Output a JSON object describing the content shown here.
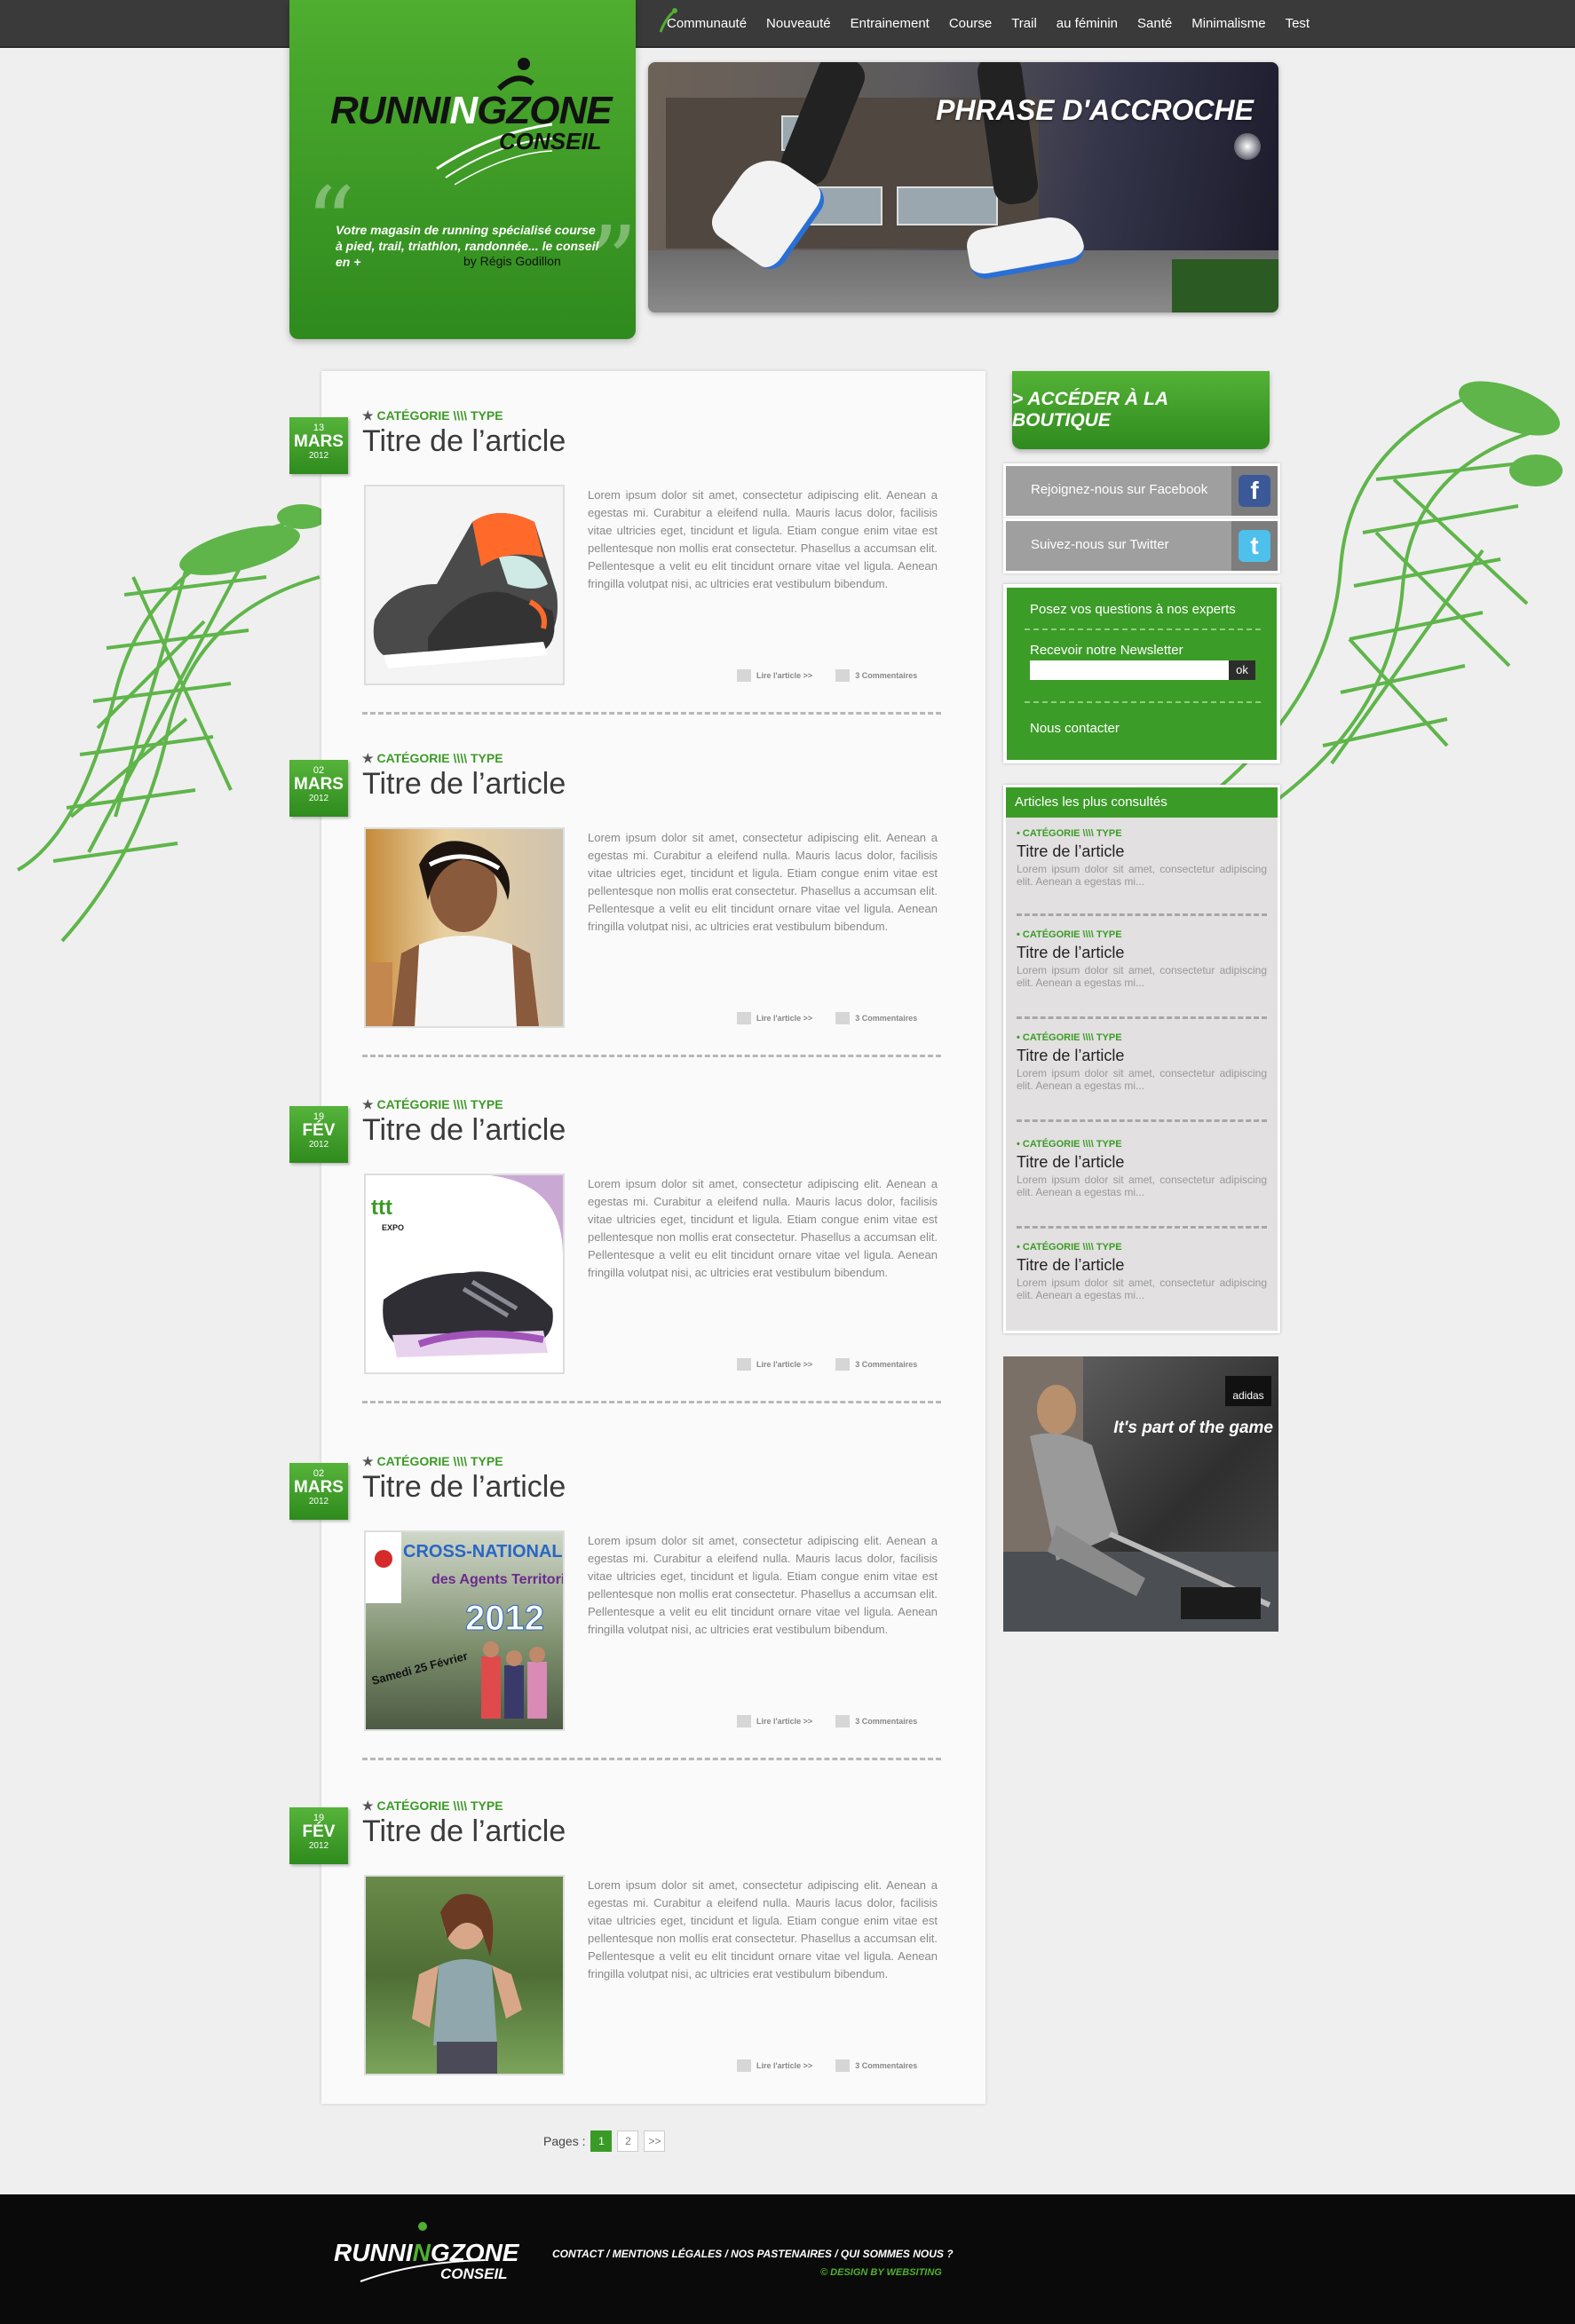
{
  "nav": {
    "items": [
      "Communauté",
      "Nouveauté",
      "Entrainement",
      "Course",
      "Trail",
      "au féminin",
      "Santé",
      "Minimalisme",
      "Test"
    ]
  },
  "brand": {
    "logo_main_left": "RUNNI",
    "logo_main_n": "N",
    "logo_main_right": "G",
    "logo_zone": "ZONE",
    "logo_sub": "CONSEIL",
    "tagline": "Votre magasin de running spécialisé course à pied, trail, triathlon, randonnée... le conseil en +",
    "tagline_author": "by Régis Godillon"
  },
  "hero": {
    "caption": "PHRASE D'ACCROCHE"
  },
  "articles": [
    {
      "day": "13",
      "month": "MARS",
      "year": "2012",
      "category_prefix": "CATÉGORIE",
      "category_sep": "\\\\\\\\",
      "category_type": "TYPE",
      "title": "Titre de l’article",
      "body": "Lorem ipsum dolor sit amet, consectetur adipiscing elit. Aenean a egestas mi. Curabitur a eleifend nulla. Mauris lacus dolor, facilisis vitae ultricies eget, tincidunt et ligula. Etiam congue enim vitae est pellentesque non mollis erat consectetur. Phasellus a accumsan elit. Pellentesque a velit eu elit tincidunt ornare vitae vel ligula. Aenean fringilla volutpat nisi, ac ultricies erat vestibulum bibendum.",
      "read_more": "Lire l'article  >>",
      "comments": "3 Commentaires"
    },
    {
      "day": "02",
      "month": "MARS",
      "year": "2012",
      "category_prefix": "CATÉGORIE",
      "category_sep": "\\\\\\\\",
      "category_type": "TYPE",
      "title": "Titre de l’article",
      "body": "Lorem ipsum dolor sit amet, consectetur adipiscing elit. Aenean a egestas mi. Curabitur a eleifend nulla. Mauris lacus dolor, facilisis vitae ultricies eget, tincidunt et ligula. Etiam congue enim vitae est pellentesque non mollis erat consectetur. Phasellus a accumsan elit. Pellentesque a velit eu elit tincidunt ornare vitae vel ligula. Aenean fringilla volutpat nisi, ac ultricies erat vestibulum bibendum.",
      "read_more": "Lire l'article  >>",
      "comments": "3 Commentaires"
    },
    {
      "day": "19",
      "month": "FÉV",
      "year": "2012",
      "category_prefix": "CATÉGORIE",
      "category_sep": "\\\\\\\\",
      "category_type": "TYPE",
      "title": "Titre de l’article",
      "body": "Lorem ipsum dolor sit amet, consectetur adipiscing elit. Aenean a egestas mi. Curabitur a eleifend nulla. Mauris lacus dolor, facilisis vitae ultricies eget, tincidunt et ligula. Etiam congue enim vitae est pellentesque non mollis erat consectetur. Phasellus a accumsan elit. Pellentesque a velit eu elit tincidunt ornare vitae vel ligula. Aenean fringilla volutpat nisi, ac ultricies erat vestibulum bibendum.",
      "read_more": "Lire l'article  >>",
      "comments": "3 Commentaires"
    },
    {
      "day": "02",
      "month": "MARS",
      "year": "2012",
      "category_prefix": "CATÉGORIE",
      "category_sep": "\\\\\\\\",
      "category_type": "TYPE",
      "title": "Titre de l’article",
      "body": "Lorem ipsum dolor sit amet, consectetur adipiscing elit. Aenean a egestas mi. Curabitur a eleifend nulla. Mauris lacus dolor, facilisis vitae ultricies eget, tincidunt et ligula. Etiam congue enim vitae est pellentesque non mollis erat consectetur. Phasellus a accumsan elit. Pellentesque a velit eu elit tincidunt ornare vitae vel ligula. Aenean fringilla volutpat nisi, ac ultricies erat vestibulum bibendum.",
      "read_more": "Lire l'article  >>",
      "comments": "3 Commentaires"
    },
    {
      "day": "19",
      "month": "FÉV",
      "year": "2012",
      "category_prefix": "CATÉGORIE",
      "category_sep": "\\\\\\\\",
      "category_type": "TYPE",
      "title": "Titre de l’article",
      "body": "Lorem ipsum dolor sit amet, consectetur adipiscing elit. Aenean a egestas mi. Curabitur a eleifend nulla. Mauris lacus dolor, facilisis vitae ultricies eget, tincidunt et ligula. Etiam congue enim vitae est pellentesque non mollis erat consectetur. Phasellus a accumsan elit. Pellentesque a velit eu elit tincidunt ornare vitae vel ligula. Aenean fringilla volutpat nisi, ac ultricies erat vestibulum bibendum.",
      "read_more": "Lire l'article  >>",
      "comments": "3 Commentaires"
    }
  ],
  "thumb_texts": {
    "expo_label": "EXPO",
    "cross_title": "CROSS-NATIONAL",
    "cross_sub": "des Agents Territoriaux",
    "cross_year": "2012",
    "cross_date": "Samedi 25 Février"
  },
  "pager": {
    "label": "Pages :",
    "pages": [
      "1",
      "2",
      ">>"
    ],
    "active": "1"
  },
  "sidebar": {
    "shop_button": "> ACCÉDER À LA BOUTIQUE",
    "facebook_label": "Rejoignez-nous sur Facebook",
    "twitter_label": "Suivez-nous sur Twitter",
    "facebook_icon": "f",
    "twitter_icon": "t",
    "experts_link": "Posez vos questions à nos experts",
    "newsletter_label": "Recevoir notre Newsletter",
    "newsletter_value": "",
    "newsletter_ok": "ok",
    "contact_link": "Nous contacter",
    "popular_title": "Articles les plus consultés",
    "popular": [
      {
        "category": "• CATÉGORIE \\\\\\\\ TYPE",
        "title": "Titre de l’article",
        "excerpt": "Lorem ipsum dolor sit amet, consectetur adipiscing elit. Aenean a egestas mi..."
      },
      {
        "category": "• CATÉGORIE \\\\\\\\ TYPE",
        "title": "Titre de l’article",
        "excerpt": "Lorem ipsum dolor sit amet, consectetur adipiscing elit. Aenean a egestas mi..."
      },
      {
        "category": "• CATÉGORIE \\\\\\\\ TYPE",
        "title": "Titre de l’article",
        "excerpt": "Lorem ipsum dolor sit amet, consectetur adipiscing elit. Aenean a egestas mi..."
      },
      {
        "category": "• CATÉGORIE \\\\\\\\ TYPE",
        "title": "Titre de l’article",
        "excerpt": "Lorem ipsum dolor sit amet, consectetur adipiscing elit. Aenean a egestas mi..."
      },
      {
        "category": "• CATÉGORIE \\\\\\\\ TYPE",
        "title": "Titre de l’article",
        "excerpt": "Lorem ipsum dolor sit amet, consectetur adipiscing elit. Aenean a egestas mi..."
      }
    ],
    "ad_brand": "adidas",
    "ad_slogan": "It's part of the game"
  },
  "footer": {
    "links": "CONTACT  /  MENTIONS LÉGALES  /  NOS PASTENAIRES  /  QUI SOMMES NOUS ?",
    "credit": "© DESIGN BY WEBSITING"
  },
  "colors": {
    "accent": "#3b9b26",
    "dark_bar": "#3a3a3a",
    "footer": "#0a0a0a"
  }
}
